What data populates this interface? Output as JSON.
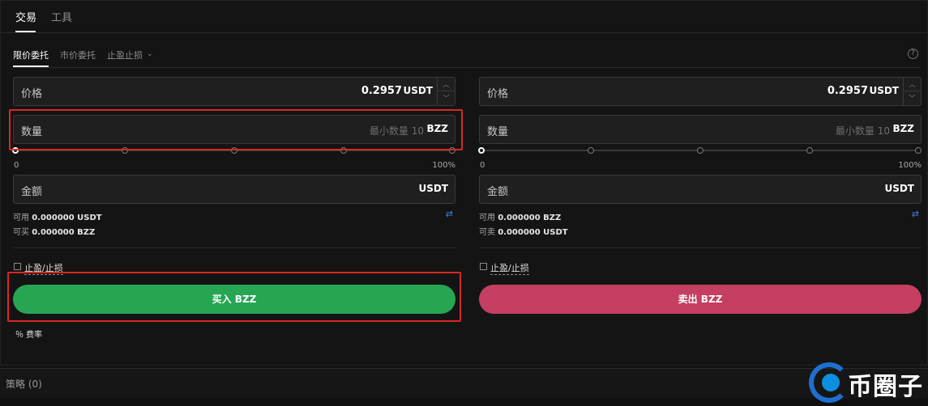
{
  "top_tabs": [
    {
      "label": "交易"
    },
    {
      "label": "工具"
    }
  ],
  "order_tabs": [
    {
      "label": "限价委托"
    },
    {
      "label": "市价委托"
    },
    {
      "label": "止盈止损"
    }
  ],
  "help_icon_glyph": "?",
  "buy": {
    "price": {
      "label": "价格",
      "value": "0.2957",
      "unit": "USDT"
    },
    "quantity": {
      "label": "数量",
      "placeholder": "最小数量 10",
      "unit": "BZZ"
    },
    "slider": {
      "min_label": "0",
      "max_label": "100%",
      "level": 0
    },
    "amount": {
      "label": "金额",
      "unit": "USDT"
    },
    "available": {
      "label": "可用",
      "value": "0.000000 USDT"
    },
    "can_trade": {
      "label": "可买",
      "value": "0.000000 BZZ"
    },
    "tpsl_label": "止盈/止损",
    "button_label": "买入 BZZ",
    "fee_label": "％ 费率",
    "button_color": "#26a653"
  },
  "sell": {
    "price": {
      "label": "价格",
      "value": "0.2957",
      "unit": "USDT"
    },
    "quantity": {
      "label": "数量",
      "placeholder": "最小数量 10",
      "unit": "BZZ"
    },
    "slider": {
      "min_label": "0",
      "max_label": "100%",
      "level": 0
    },
    "amount": {
      "label": "金额",
      "unit": "USDT"
    },
    "available": {
      "label": "可用",
      "value": "0.000000 BZZ"
    },
    "can_trade": {
      "label": "可卖",
      "value": "0.000000 USDT"
    },
    "tpsl_label": "止盈/止损",
    "button_label": "卖出 BZZ",
    "button_color": "#c43f61"
  },
  "strategy": {
    "label": "策略 (0)"
  },
  "watermark": {
    "text": "币圈子"
  },
  "colors": {
    "accent_blue": "#3b82f6",
    "highlight_red": "#d62a22"
  }
}
